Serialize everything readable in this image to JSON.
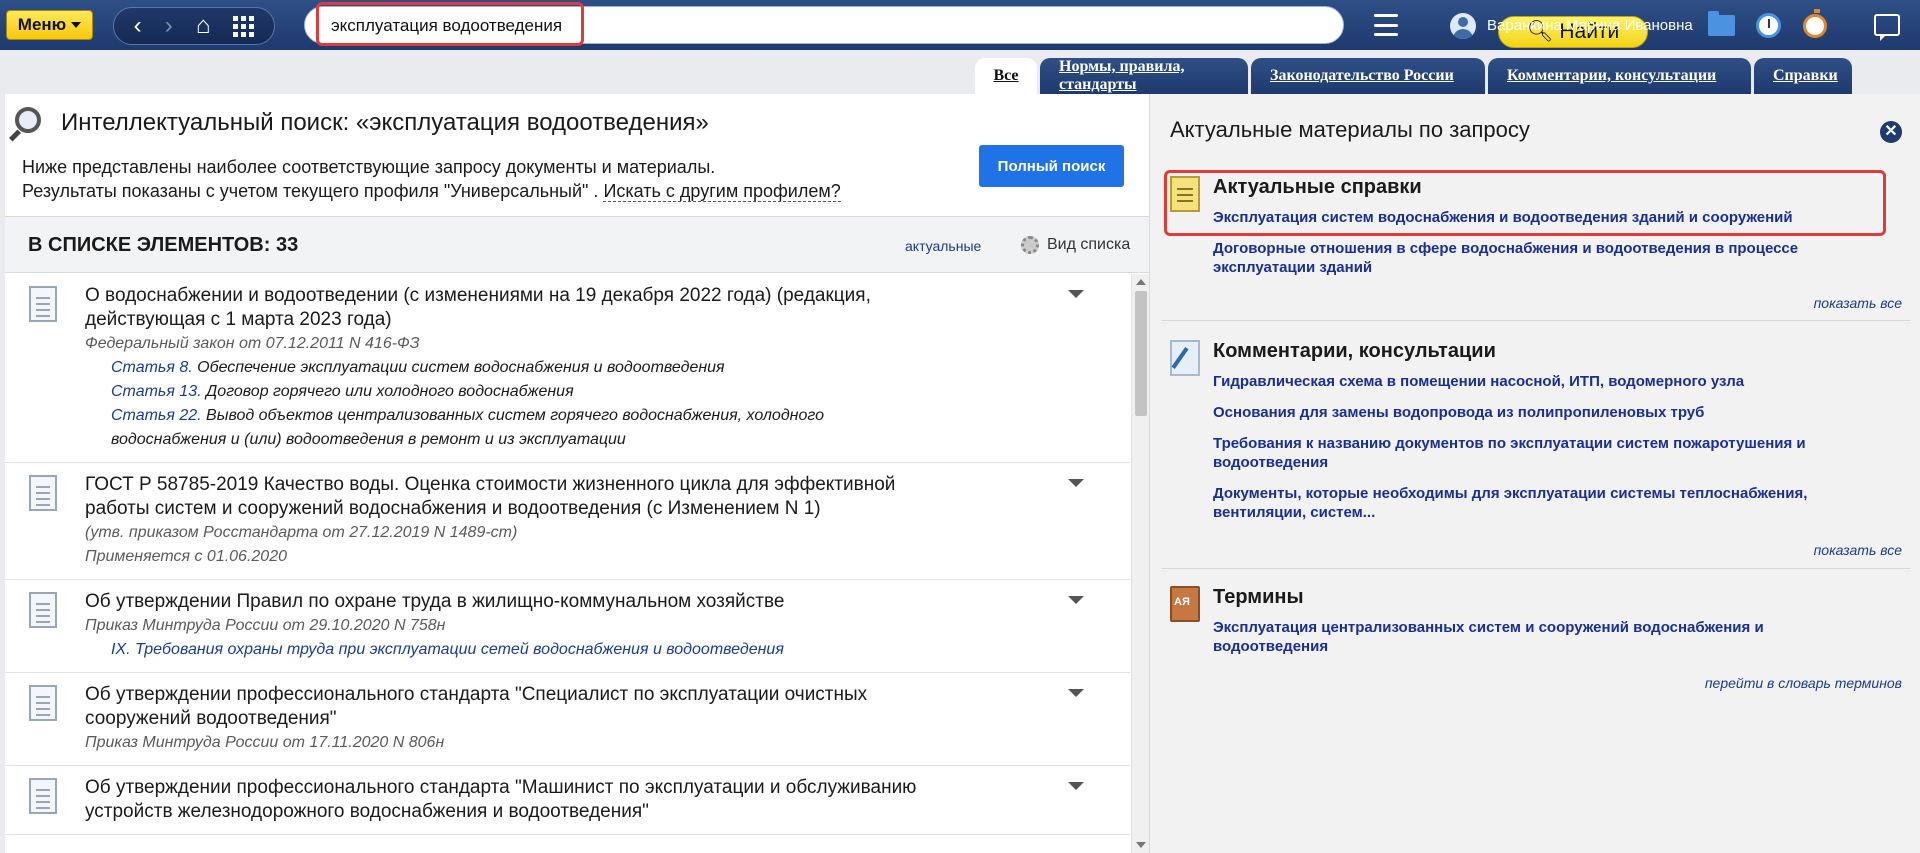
{
  "topbar": {
    "menu_label": "Меню",
    "search_value": "эксплуатация водоотведения",
    "find_label": "Найти",
    "user_name": "Варанкина Марина Ивановна"
  },
  "tabs": [
    {
      "label": "Все",
      "active": true
    },
    {
      "label": "Нормы, правила, стандарты",
      "active": false
    },
    {
      "label": "Законодательство России",
      "active": false
    },
    {
      "label": "Комментарии, консультации",
      "active": false
    },
    {
      "label": "Справки",
      "active": false
    }
  ],
  "search_header": {
    "title": "Интеллектуальный поиск: «эксплуатация водоотведения»",
    "desc_line1": "Ниже представлены наиболее соответствующие запросу документы и материалы.",
    "desc_line2": "Результаты показаны с учетом текущего профиля \"Универсальный\" .",
    "other_profile_link": "Искать с другим профилем?",
    "full_search_label": "Полный поиск"
  },
  "list_header": {
    "count_label": "В СПИСКЕ ЭЛЕМЕНТОВ:",
    "count": "33",
    "actual_link": "актуальные",
    "view_list_label": "Вид списка"
  },
  "documents": [
    {
      "title": "О водоснабжении и водоотведении (с изменениями на 19 декабря 2022 года) (редакция, действующая с 1 марта 2023 года)",
      "subtitle": "Федеральный закон от 07.12.2011 N 416-ФЗ",
      "articles": [
        {
          "link": "Статья 8.",
          "text": " Обеспечение эксплуатации систем водоснабжения и водоотведения"
        },
        {
          "link": "Статья 13.",
          "text": " Договор горячего или холодного водоснабжения"
        },
        {
          "link": "Статья 22.",
          "text": " Вывод объектов централизованных систем горячего водоснабжения, холодного водоснабжения и (или) водоотведения в ремонт и из эксплуатации"
        }
      ]
    },
    {
      "title": "ГОСТ Р 58785-2019 Качество воды. Оценка стоимости жизненного цикла для эффективной работы систем и сооружений водоснабжения и водоотведения (с Изменением N 1)",
      "subtitle": "(утв. приказом Росстандарта от 27.12.2019 N 1489-ст)",
      "subtitle2": "Применяется с 01.06.2020"
    },
    {
      "title": "Об утверждении Правил по охране труда в жилищно-коммунальном хозяйстве",
      "subtitle": "Приказ Минтруда России от 29.10.2020 N 758н",
      "section_link": "IX. Требования охраны труда при эксплуатации сетей водоснабжения и водоотведения"
    },
    {
      "title": "Об утверждении профессионального стандарта \"Специалист по эксплуатации очистных сооружений водоотведения\"",
      "subtitle": "Приказ Минтруда России от 17.11.2020 N 806н"
    },
    {
      "title": "Об утверждении профессионального стандарта \"Машинист по эксплуатации и обслуживанию устройств железнодорожного водоснабжения и водоотведения\""
    }
  ],
  "right_panel": {
    "title": "Актуальные материалы по запросу",
    "sections": [
      {
        "title": "Актуальные справки",
        "icon": "reference-icon",
        "links": [
          "Эксплуатация систем водоснабжения и водоотведения зданий и сооружений",
          "Договорные отношения в сфере водоснабжения и водоотведения в процессе эксплуатации зданий"
        ],
        "more": "показать все"
      },
      {
        "title": "Комментарии, консультации",
        "icon": "comment-pen-icon",
        "links": [
          "Гидравлическая схема в помещении насосной, ИТП, водомерного узла",
          "Основания для замены водопровода из полипропиленовых труб",
          "Требования к названию документов по эксплуатации систем пожаротушения и водоотведения",
          "Документы, которые необходимы для эксплуатации системы теплоснабжения, вентиляции, систем..."
        ],
        "more": "показать все"
      },
      {
        "title": "Термины",
        "icon": "dictionary-icon",
        "links": [
          "Эксплуатация централизованных систем и сооружений водоснабжения и водоотведения"
        ],
        "more": "перейти в словарь терминов"
      }
    ]
  },
  "colors": {
    "topbar": "#1e3a6e",
    "accent_yellow": "#f6c90c",
    "link_blue": "#1a2f95",
    "highlight_red": "#e03a3a",
    "button_blue": "#1f73e6"
  }
}
